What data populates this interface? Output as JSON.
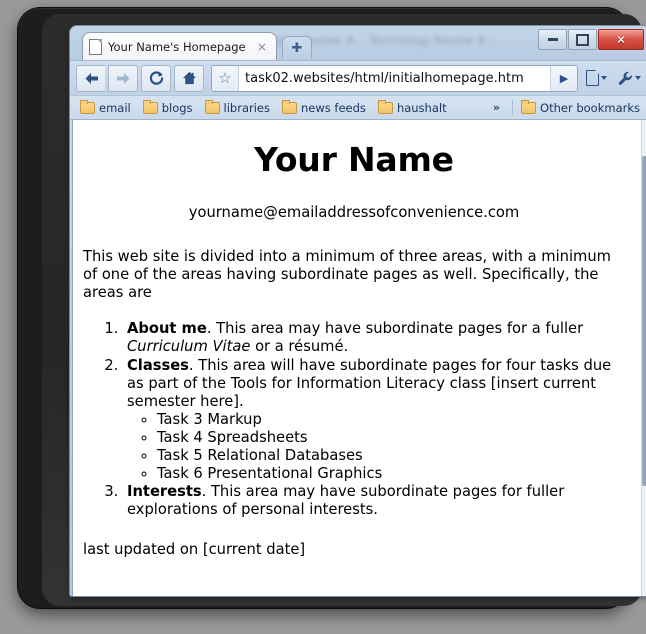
{
  "window": {
    "controls": {
      "minimize_label": "–",
      "restore_label": "□",
      "close_label": "✕"
    }
  },
  "tabstrip": {
    "active_tab": {
      "title": "Your Name's Homepage",
      "icon": "page-icon",
      "close_label": "×"
    },
    "new_tab_label": "✚",
    "ghost_tabs_text": "ging Review #…  Technology Review #…"
  },
  "toolbar": {
    "back_label": "←",
    "forward_label": "→",
    "reload_label": "⟳",
    "home_label": "⌂",
    "star_label": "☆",
    "go_label": "▶",
    "page_menu_label": "page-menu",
    "wrench_menu_label": "wrench-menu",
    "url": "task02.websites/html/initialhomepage.htm"
  },
  "bookmarks": {
    "items": [
      {
        "label": "email"
      },
      {
        "label": "blogs"
      },
      {
        "label": "libraries"
      },
      {
        "label": "news feeds"
      },
      {
        "label": "haushalt"
      }
    ],
    "overflow_label": "»",
    "other_label": "Other bookmarks"
  },
  "page": {
    "title": "Your Name",
    "email": "yourname@emailaddressofconvenience.com",
    "intro": "This web site is divided into a minimum of three areas, with a minimum of one of the areas having subordinate pages as well. Specifically, the areas are",
    "areas": [
      {
        "term": "About me",
        "text_before_italic": ". This area may have subordinate pages for a fuller ",
        "italic": "Curriculum Vitae",
        "text_after_italic": " or a résumé."
      },
      {
        "term": "Classes",
        "text": ". This area will have subordinate pages for four tasks due as part of the Tools for Information Literacy class [insert current semester here].",
        "subitems": [
          {
            "label": "Task 3 Markup"
          },
          {
            "label": "Task 4 Spreadsheets"
          },
          {
            "label": "Task 5 Relational Databases"
          },
          {
            "label": "Task 6 Presentational Graphics"
          }
        ]
      },
      {
        "term": "Interests",
        "text": ". This area may have subordinate pages for fuller explorations of personal interests."
      }
    ],
    "updated": "last updated on [current date]"
  }
}
